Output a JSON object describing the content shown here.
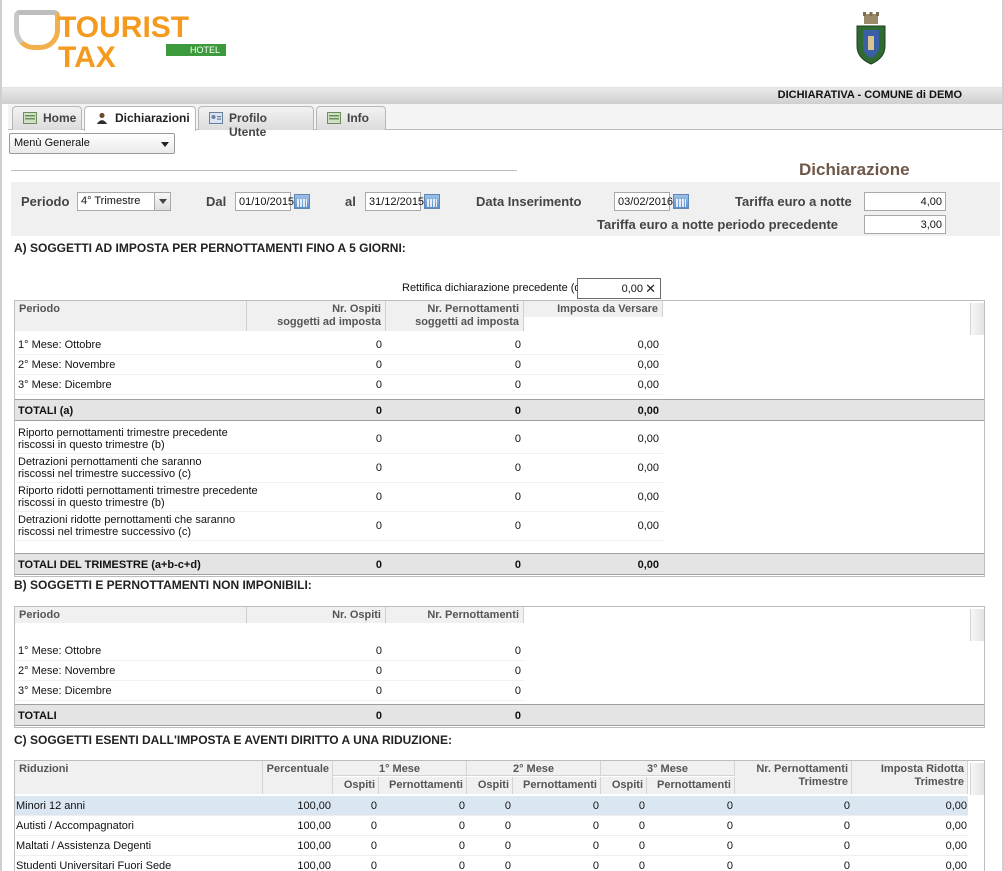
{
  "app": {
    "logo_text": "TOURIST TAX",
    "logo_sub": "HOTEL",
    "title_bar": "DICHIARATIVA - COMUNE di DEMO"
  },
  "tabs": [
    {
      "label": "Home",
      "icon": "home-icon"
    },
    {
      "label": "Dichiarazioni",
      "icon": "user-icon"
    },
    {
      "label": "Profilo Utente",
      "icon": "profile-card-icon"
    },
    {
      "label": "Info",
      "icon": "info-icon"
    }
  ],
  "menu": {
    "selected": "Menù Generale"
  },
  "page_heading": "Dichiarazione",
  "filters": {
    "periodo_label": "Periodo",
    "periodo_value": "4° Trimestre",
    "dal_label": "Dal",
    "dal_value": "01/10/2015",
    "al_label": "al",
    "al_value": "31/12/2015",
    "data_ins_label": "Data Inserimento",
    "data_ins_value": "03/02/2016",
    "tariffa_label": "Tariffa euro a notte",
    "tariffa_value": "4,00",
    "tariffa_prec_label": "Tariffa euro a notte periodo precedente",
    "tariffa_prec_value": "3,00"
  },
  "section_a": {
    "title": "A) SOGGETTI AD IMPOSTA PER PERNOTTAMENTI FINO A 5 GIORNI:",
    "rettifica_label": "Rettifica dichiarazione precedente (d)",
    "rettifica_value": "0,00",
    "headers": [
      "Periodo",
      "Nr. Ospiti soggetti ad imposta",
      "Nr. Pernottamenti soggetti ad imposta",
      "Imposta da Versare"
    ],
    "headers_l1": [
      "Periodo",
      "Nr. Ospiti",
      "Nr. Pernottamenti",
      "Imposta da Versare"
    ],
    "headers_l2": [
      "",
      "soggetti ad imposta",
      "soggetti ad imposta",
      ""
    ],
    "months": [
      {
        "label": "1° Mese: Ottobre",
        "ospiti": "0",
        "pern": "0",
        "imposta": "0,00"
      },
      {
        "label": "2° Mese: Novembre",
        "ospiti": "0",
        "pern": "0",
        "imposta": "0,00"
      },
      {
        "label": "3° Mese: Dicembre",
        "ospiti": "0",
        "pern": "0",
        "imposta": "0,00"
      }
    ],
    "totali": {
      "label": "TOTALI (a)",
      "ospiti": "0",
      "pern": "0",
      "imposta": "0,00"
    },
    "adjustments": [
      {
        "l1": "Riporto pernottamenti trimestre precedente",
        "l2": "riscossi in questo trimestre (b)",
        "ospiti": "0",
        "pern": "0",
        "imposta": "0,00"
      },
      {
        "l1": "Detrazioni pernottamenti che saranno",
        "l2": "riscossi nel trimestre successivo (c)",
        "ospiti": "0",
        "pern": "0",
        "imposta": "0,00"
      },
      {
        "l1": "Riporto ridotti pernottamenti trimestre precedente",
        "l2": "riscossi in questo trimestre (b)",
        "ospiti": "0",
        "pern": "0",
        "imposta": "0,00"
      },
      {
        "l1": "Detrazioni ridotte pernottamenti che saranno",
        "l2": "riscossi nel trimestre successivo (c)",
        "ospiti": "0",
        "pern": "0",
        "imposta": "0,00"
      }
    ],
    "totali_trimestre": {
      "label": "TOTALI DEL TRIMESTRE (a+b-c+d)",
      "ospiti": "0",
      "pern": "0",
      "imposta": "0,00"
    }
  },
  "section_b": {
    "title": "B) SOGGETTI E PERNOTTAMENTI NON IMPONIBILI:",
    "headers": [
      "Periodo",
      "Nr. Ospiti",
      "Nr. Pernottamenti"
    ],
    "months": [
      {
        "label": "1° Mese: Ottobre",
        "ospiti": "0",
        "pern": "0"
      },
      {
        "label": "2° Mese: Novembre",
        "ospiti": "0",
        "pern": "0"
      },
      {
        "label": "3° Mese: Dicembre",
        "ospiti": "0",
        "pern": "0"
      }
    ],
    "totali": {
      "label": "TOTALI",
      "ospiti": "0",
      "pern": "0"
    }
  },
  "section_c": {
    "title": "C) SOGGETTI ESENTI DALL'IMPOSTA E AVENTI DIRITTO A UNA RIDUZIONE:",
    "h_riduzioni": "Riduzioni",
    "h_percentuale": "Percentuale",
    "h_mese1": "1° Mese",
    "h_mese2": "2° Mese",
    "h_mese3": "3° Mese",
    "h_ospiti": "Ospiti",
    "h_pern": "Pernottamenti",
    "h_nr_pern_l1": "Nr. Pernottamenti",
    "h_nr_pern_l2": "Trimestre",
    "h_imp_rid_l1": "Imposta Ridotta",
    "h_imp_rid_l2": "Trimestre",
    "rows": [
      {
        "label": "Minori 12 anni",
        "perc": "100,00",
        "o1": "0",
        "p1": "0",
        "o2": "0",
        "p2": "0",
        "o3": "0",
        "p3": "0",
        "tot": "0",
        "imp": "0,00"
      },
      {
        "label": "Autisti / Accompagnatori",
        "perc": "100,00",
        "o1": "0",
        "p1": "0",
        "o2": "0",
        "p2": "0",
        "o3": "0",
        "p3": "0",
        "tot": "0",
        "imp": "0,00"
      },
      {
        "label": "Maltati / Assistenza Degenti",
        "perc": "100,00",
        "o1": "0",
        "p1": "0",
        "o2": "0",
        "p2": "0",
        "o3": "0",
        "p3": "0",
        "tot": "0",
        "imp": "0,00"
      },
      {
        "label": "Studenti Universitari Fuori Sede",
        "perc": "100,00",
        "o1": "0",
        "p1": "0",
        "o2": "0",
        "p2": "0",
        "o3": "0",
        "p3": "0",
        "tot": "0",
        "imp": "0,00"
      }
    ]
  }
}
